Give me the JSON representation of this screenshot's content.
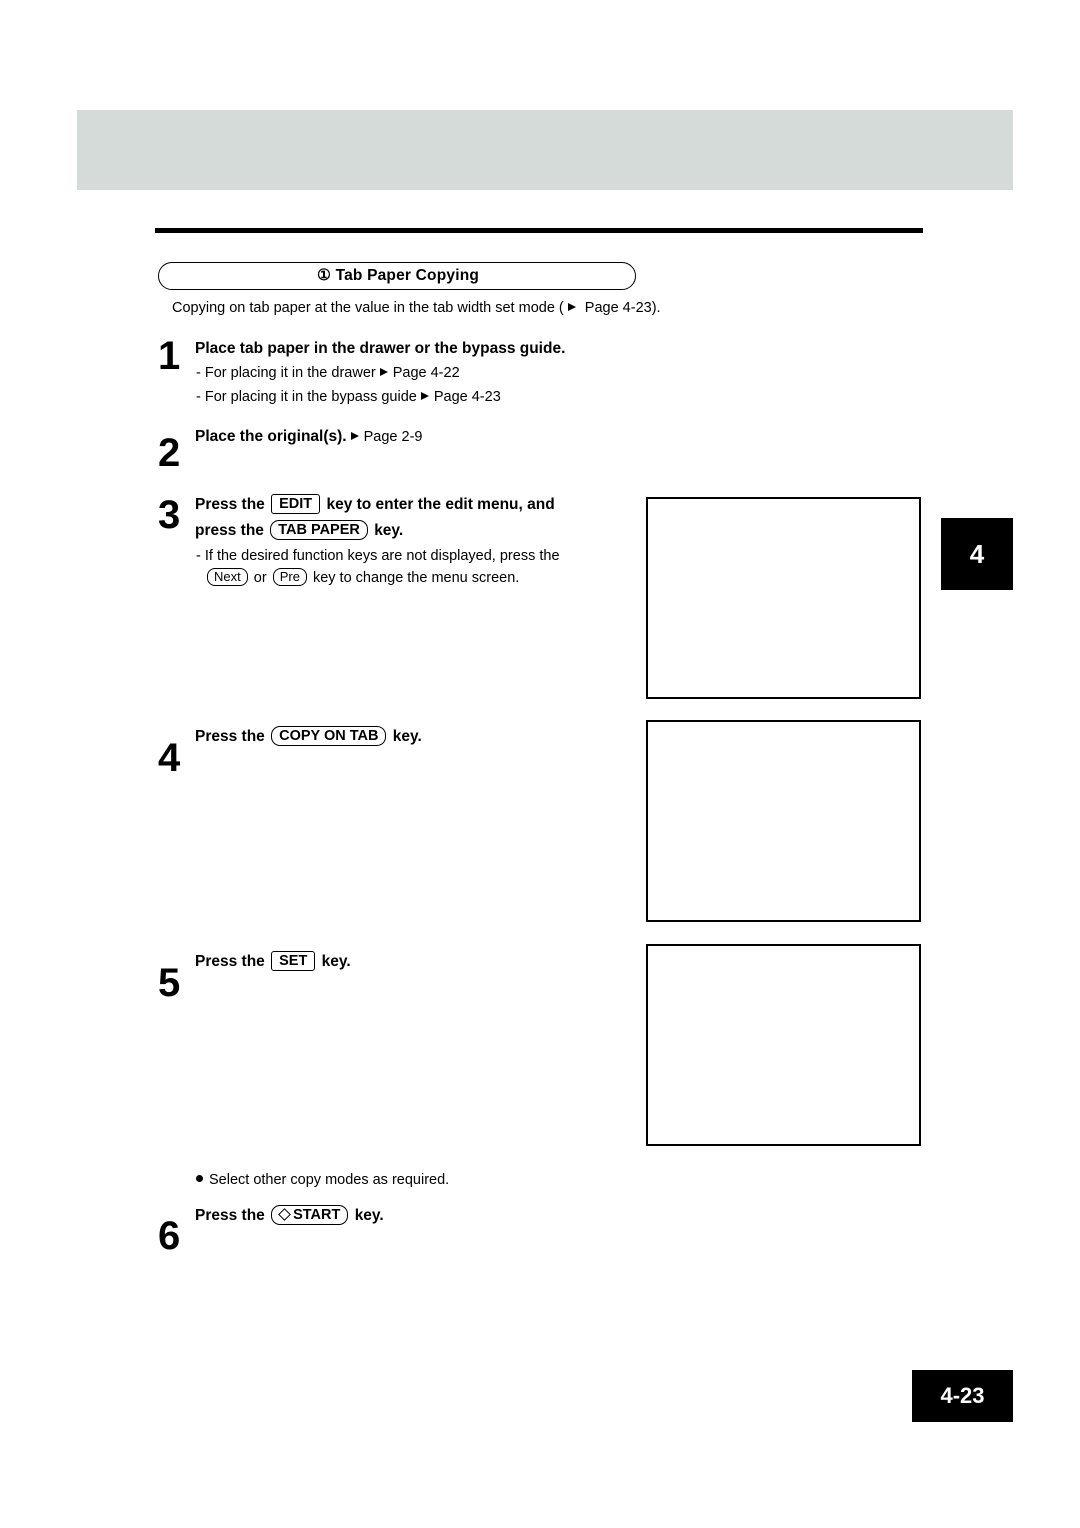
{
  "document": {
    "chapter_tab": "4",
    "page_number": "4-23",
    "section": {
      "marker": "①",
      "title": "Tab Paper Copying"
    },
    "intro": {
      "before_arrow": "Copying on tab paper at the value in the tab width set mode (",
      "after_arrow": " Page 4-23)."
    },
    "steps": [
      {
        "number": "1",
        "title": "Place tab paper in the drawer or the bypass guide.",
        "sub_lines": [
          {
            "before_arrow": "-  For placing it in the drawer",
            "after_arrow": "Page 4-22"
          },
          {
            "before_arrow": "-  For placing it in the bypass guide",
            "after_arrow": "Page 4-23"
          }
        ]
      },
      {
        "number": "2",
        "title_before": "Place the original(s).",
        "title_after": "Page 2-9"
      },
      {
        "number": "3",
        "line1_a": "Press the",
        "key_edit": "EDIT",
        "line1_b": "key to enter the edit menu, and",
        "line2_a": "press the",
        "key_tab_paper": "TAB PAPER",
        "line2_b": "key.",
        "note_line1": "-  If the desired function keys are not displayed, press the",
        "note_key_next": "Next",
        "note_or": "or",
        "note_key_pre": "Pre",
        "note_line2_end": "key to change the menu screen."
      },
      {
        "number": "4",
        "line_a": "Press the",
        "key": "COPY ON TAB",
        "line_b": "key."
      },
      {
        "number": "5",
        "line_a": "Press the",
        "key": "SET",
        "line_b": "key."
      },
      {
        "number": "6",
        "line_a": "Press the",
        "key": "START",
        "line_b": "key."
      }
    ],
    "bullet_note": "Select other copy modes as required."
  }
}
